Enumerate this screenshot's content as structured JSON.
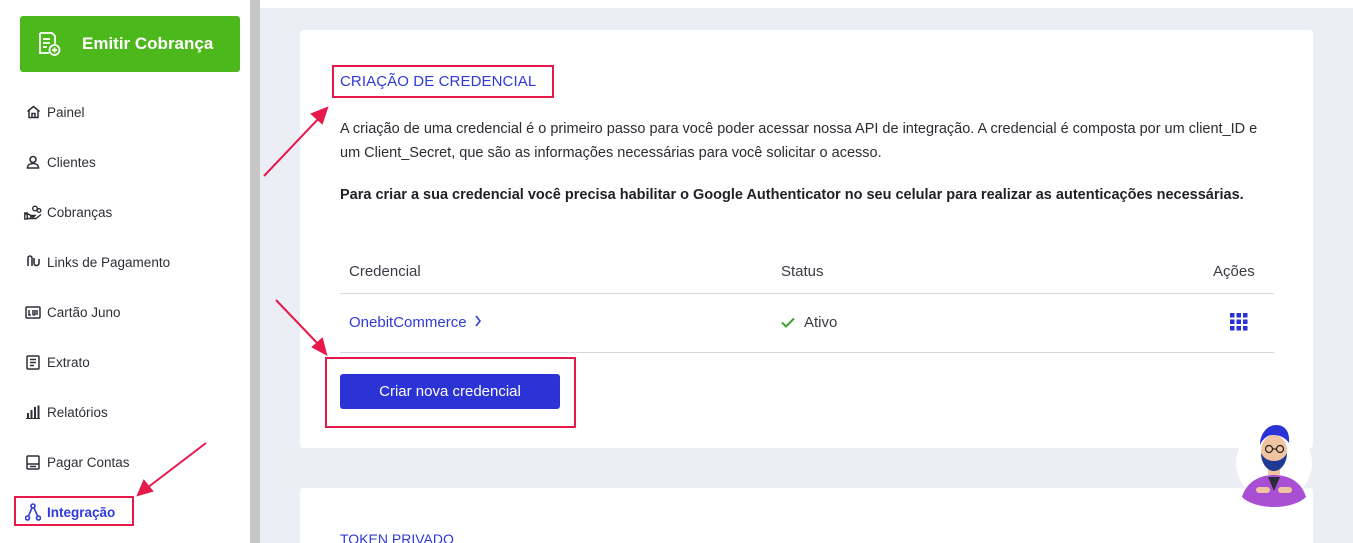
{
  "sidebar": {
    "emit_button_label": "Emitir Cobrança",
    "items": [
      {
        "label": "Painel",
        "icon": "home-icon"
      },
      {
        "label": "Clientes",
        "icon": "user-icon"
      },
      {
        "label": "Cobranças",
        "icon": "hand-coins-icon"
      },
      {
        "label": "Links de Pagamento",
        "icon": "link-icon"
      },
      {
        "label": "Cartão Juno",
        "icon": "card-icon"
      },
      {
        "label": "Extrato",
        "icon": "document-icon"
      },
      {
        "label": "Relatórios",
        "icon": "bar-chart-icon"
      },
      {
        "label": "Pagar Contas",
        "icon": "barcode-icon"
      },
      {
        "label": "Integração",
        "icon": "integration-icon",
        "active": true
      }
    ]
  },
  "card": {
    "title": "CRIAÇÃO DE CREDENCIAL",
    "description": "A criação de uma credencial é o primeiro passo para você poder acessar nossa API de integração. A credencial é composta por um client_ID e um Client_Secret, que são as informações necessárias para você solicitar o acesso.",
    "notice": "Para criar a sua credencial você precisa habilitar o Google Authenticator no seu celular para realizar as autenticações necessárias.",
    "table": {
      "headers": {
        "credential": "Credencial",
        "status": "Status",
        "actions": "Ações"
      },
      "rows": [
        {
          "credential": "OnebitCommerce",
          "status": "Ativo"
        }
      ]
    },
    "create_button_label": "Criar nova credencial"
  },
  "token_card": {
    "title": "TOKEN PRIVADO"
  },
  "colors": {
    "accent": "#2f3ad8",
    "primary_button": "#2b32d6",
    "emit_button": "#4cb81c",
    "highlight": "#e6194b",
    "status_ok": "#3aa52a"
  }
}
